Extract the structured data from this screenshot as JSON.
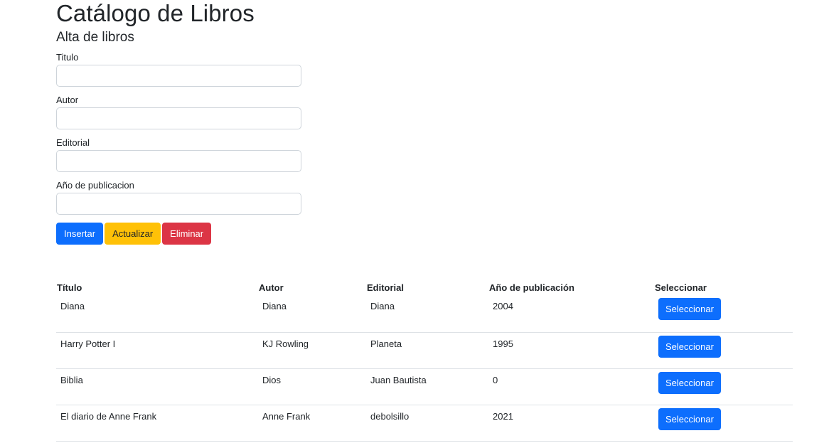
{
  "page": {
    "title": "Catálogo de Libros",
    "subtitle": "Alta de libros"
  },
  "form": {
    "fields": [
      {
        "label": "Titulo",
        "value": "",
        "placeholder": ""
      },
      {
        "label": "Autor",
        "value": "",
        "placeholder": ""
      },
      {
        "label": "Editorial",
        "value": "",
        "placeholder": ""
      },
      {
        "label": "Año de publicacion",
        "value": "",
        "placeholder": ""
      }
    ],
    "buttons": {
      "insert": "Insertar",
      "update": "Actualizar",
      "delete": "Eliminar"
    }
  },
  "table": {
    "headers": [
      "Título",
      "Autor",
      "Editorial",
      "Año de publicación",
      "Seleccionar"
    ],
    "select_label": "Seleccionar",
    "rows": [
      {
        "titulo": "Diana",
        "autor": "Diana",
        "editorial": "Diana",
        "anio": "2004"
      },
      {
        "titulo": "Harry Potter I",
        "autor": "KJ Rowling",
        "editorial": "Planeta",
        "anio": "1995"
      },
      {
        "titulo": "Biblia",
        "autor": "Dios",
        "editorial": "Juan Bautista",
        "anio": "0"
      },
      {
        "titulo": "El diario de Anne Frank",
        "autor": "Anne Frank",
        "editorial": "debolsillo",
        "anio": "2021"
      }
    ]
  },
  "colors": {
    "primary": "#0d6efd",
    "warning": "#ffc107",
    "danger": "#dc3545",
    "text": "#212529",
    "border": "#ced4da",
    "row_divider": "#dee2e6"
  }
}
